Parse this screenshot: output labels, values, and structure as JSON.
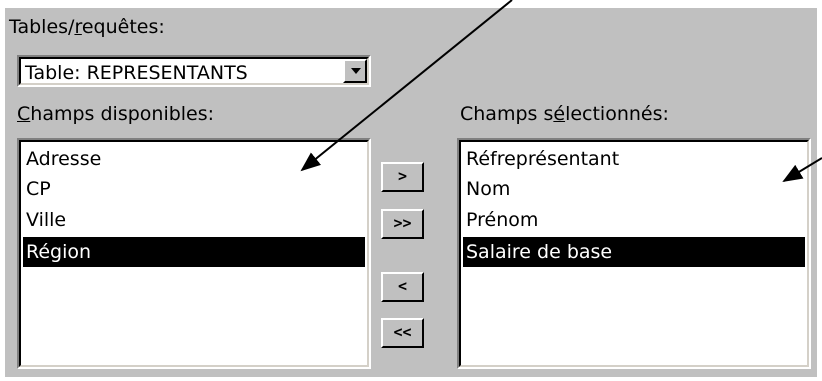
{
  "labels": {
    "tables_query_prefix": "Tables/",
    "tables_query_ul": "r",
    "tables_query_suffix": "equêtes:",
    "available_ul": "C",
    "available_suffix": "hamps disponibles:",
    "selected_prefix": "Champs s",
    "selected_ul": "é",
    "selected_suffix": "lectionnés:"
  },
  "combo": {
    "value": "Table: REPRESENTANTS"
  },
  "available_fields": [
    {
      "label": "Adresse",
      "selected": false
    },
    {
      "label": "CP",
      "selected": false
    },
    {
      "label": "Ville",
      "selected": false
    },
    {
      "label": "Région",
      "selected": true
    }
  ],
  "selected_fields": [
    {
      "label": "Réfreprésentant",
      "selected": false
    },
    {
      "label": "Nom",
      "selected": false
    },
    {
      "label": "Prénom",
      "selected": false
    },
    {
      "label": "Salaire de base",
      "selected": true
    }
  ],
  "buttons": {
    "add_one": ">",
    "add_all": ">>",
    "remove_one": "<",
    "remove_all": "<<"
  }
}
